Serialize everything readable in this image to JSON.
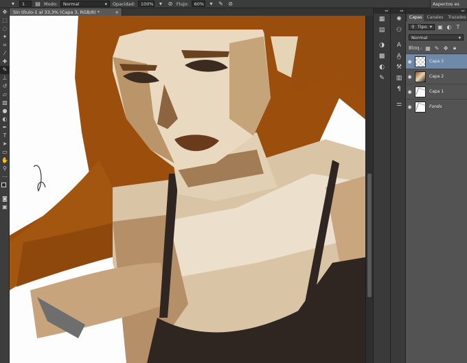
{
  "options_bar": {
    "mode_label": "Modo:",
    "mode_value": "Normal",
    "opacity_label": "Opacidad:",
    "opacity_value": "100%",
    "flow_label": "Flujo:",
    "flow_value": "60%",
    "brush_size": "1"
  },
  "workspace": {
    "label": "Aspectos es"
  },
  "document": {
    "tab_title": "Sin título-1 al 33,3% (Capa 3, RGB/8) *",
    "close": "×"
  },
  "layers_panel": {
    "tabs": [
      {
        "label": "Capas",
        "active": true
      },
      {
        "label": "Canales",
        "active": false
      },
      {
        "label": "Trazados",
        "active": false
      }
    ],
    "filter_value": "Tipo",
    "blend_value": "Normal",
    "lock_label": "Bloq.:",
    "layers": [
      {
        "name": "Capa 3",
        "selected": true,
        "thumb": "transparent",
        "italic": false
      },
      {
        "name": "Capa 2",
        "selected": false,
        "thumb": "art",
        "italic": false
      },
      {
        "name": "Capa 1",
        "selected": false,
        "thumb": "sketch",
        "italic": false
      },
      {
        "name": "Fondo",
        "selected": false,
        "thumb": "sketch",
        "italic": true
      }
    ]
  },
  "colors": {
    "hair": "#9c4f0d",
    "skin_light": "#e9dcc8",
    "skin_mid": "#c9a67e",
    "skin_shadow": "#8a6440",
    "top": "#2f2622",
    "ui_dark": "#282828",
    "selection": "#6e89aa"
  }
}
